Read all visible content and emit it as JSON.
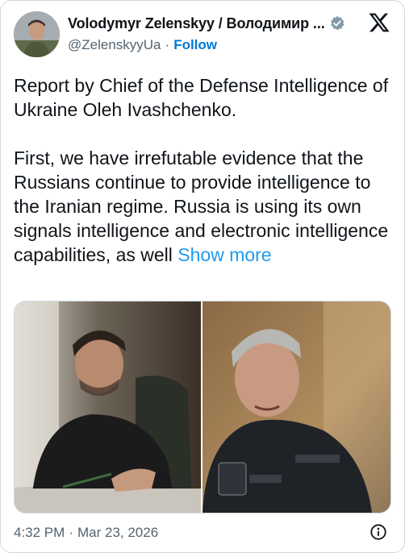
{
  "author": {
    "display_name": "Volodymyr Zelenskyy / Володимир ...",
    "handle": "@ZelenskyyUa",
    "separator": "·",
    "follow_label": "Follow",
    "verified": true
  },
  "platform_icon": "x-logo-icon",
  "tweet": {
    "text": "Report by Chief of the Defense Intelligence of Ukraine Oleh Ivashchenko.\n\nFirst, we have irrefutable evidence that the Russians continue to provide intelligence to the Iranian regime. Russia is using its own signals intelligence and electronic intelligence capabilities, as well ",
    "show_more_label": "Show more"
  },
  "media": [
    {
      "icon": "photo-zelensky-at-desk"
    },
    {
      "icon": "photo-ivashchenko-speaking"
    }
  ],
  "footer": {
    "time": "4:32 PM",
    "separator": "·",
    "date": "Mar 23, 2026",
    "info_icon": "info-icon"
  },
  "colors": {
    "link": "#1d9bf0",
    "follow": "#0079d3",
    "secondary_text": "#536471",
    "border": "#cfd9de"
  }
}
